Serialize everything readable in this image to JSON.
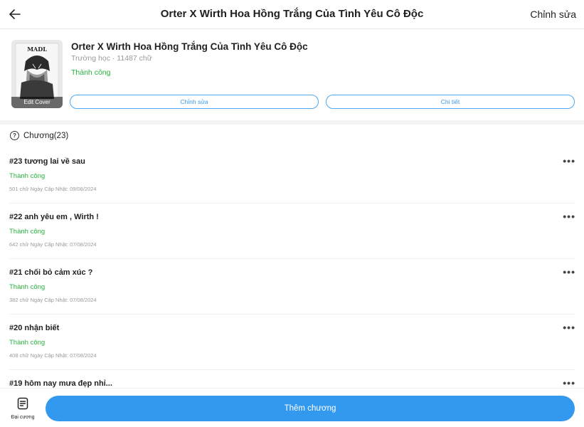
{
  "header": {
    "title": "Orter X Wirth Hoa Hồng Trắng Của Tình Yêu Cô Độc",
    "edit_label": "Chỉnh sửa",
    "back_icon": "arrow-left-icon"
  },
  "story": {
    "title": "Orter X Wirth Hoa Hồng Trắng Của Tình Yêu Cô Độc",
    "meta": "Trường học · 11487 chữ",
    "status": "Thành công",
    "cover_label": "Edit Cover",
    "edit_button": "Chỉnh sửa",
    "detail_button": "Chi tiết"
  },
  "chapters": {
    "heading": "Chương(23)",
    "items": [
      {
        "title": "#23 tương lai về sau",
        "status": "Thành công",
        "meta": "501 chữ Ngày Cập Nhật: 09/08/2024"
      },
      {
        "title": "#22 anh yêu em , Wirth !",
        "status": "Thành công",
        "meta": "642 chữ Ngày Cập Nhật: 07/08/2024"
      },
      {
        "title": "#21 chối bỏ cảm xúc ?",
        "status": "Thành công",
        "meta": "382 chữ Ngày Cập Nhật: 07/08/2024"
      },
      {
        "title": "#20 nhận biết",
        "status": "Thành công",
        "meta": "408 chữ Ngày Cập Nhật: 07/08/2024"
      },
      {
        "title": "#19 hôm nay mưa đẹp nhỉ...",
        "status": "",
        "meta": ""
      }
    ]
  },
  "bottom": {
    "outline_label": "Đại cương",
    "add_chapter_label": "Thêm chương"
  },
  "colors": {
    "accent": "#3399ee",
    "success": "#27b33d",
    "muted": "#9a9a9a"
  }
}
